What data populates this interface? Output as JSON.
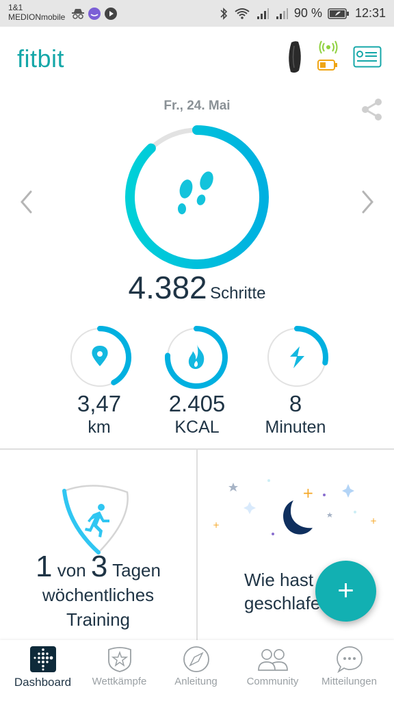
{
  "status_bar": {
    "carrier_line1": "1&1",
    "carrier_line2": "MEDIONmobile",
    "left_icons": [
      "incognito-icon",
      "app-notification-icon",
      "play-icon"
    ],
    "right_icons": [
      "bluetooth-icon",
      "wifi-icon",
      "signal-icon",
      "signal-icon-2"
    ],
    "battery_percent": "90 %",
    "time": "12:31"
  },
  "app_bar": {
    "logo": "fitbit",
    "tracker_icon": "fitbit-tracker-icon",
    "sync_icon": "sync-signal-icon",
    "battery_icon": "tracker-battery-icon",
    "profile_icon": "profile-card-icon"
  },
  "colors": {
    "brand": "#14a7a8",
    "ring": "#00b0e0",
    "ring_start": "#00d0d8",
    "track": "#e2e2e2",
    "text": "#1f3445",
    "sync": "#8fd13f",
    "battery": "#f0a514",
    "moon": "#0f2f5e",
    "fab": "#12b0b2"
  },
  "main": {
    "date": "Fr., 24. Mai",
    "steps_value": "4.382",
    "steps_unit": "Schritte",
    "steps_progress": 0.88,
    "prev_label": "previous-day",
    "next_label": "next-day"
  },
  "stats": [
    {
      "value": "3,47",
      "unit": "km",
      "icon": "location-pin-icon",
      "progress": 0.42
    },
    {
      "value": "2.405",
      "unit": "KCAL",
      "icon": "flame-icon",
      "progress": 0.76
    },
    {
      "value": "8",
      "unit": "Minuten",
      "icon": "lightning-icon",
      "progress": 0.28
    }
  ],
  "tiles": {
    "exercise": {
      "current": "1",
      "von": "von",
      "goal": "3",
      "tagen": "Tagen",
      "line2": "wöchentliches",
      "line3": "Training",
      "progress": 0.33
    },
    "sleep": {
      "line1": "Wie hast",
      "line2": "geschlafen?"
    }
  },
  "fab": {
    "label": "+"
  },
  "nav": [
    {
      "label": "Dashboard",
      "active": true
    },
    {
      "label": "Wettkämpfe",
      "active": false
    },
    {
      "label": "Anleitung",
      "active": false
    },
    {
      "label": "Community",
      "active": false
    },
    {
      "label": "Mitteilungen",
      "active": false
    }
  ]
}
